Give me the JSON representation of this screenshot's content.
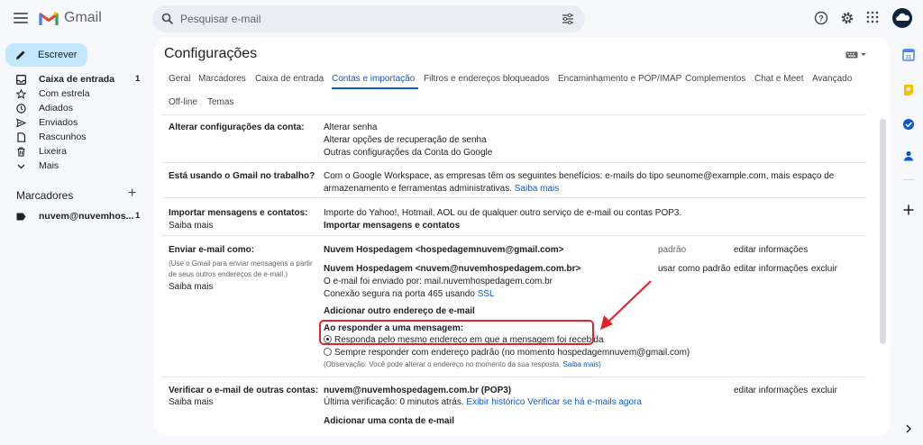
{
  "app": {
    "name": "Gmail"
  },
  "search": {
    "placeholder": "Pesquisar e-mail"
  },
  "nav": {
    "compose_label": "Escrever",
    "items": [
      {
        "label": "Caixa de entrada",
        "count": "1"
      },
      {
        "label": "Com estrela",
        "count": ""
      },
      {
        "label": "Adiados",
        "count": ""
      },
      {
        "label": "Enviados",
        "count": ""
      },
      {
        "label": "Rascunhos",
        "count": ""
      },
      {
        "label": "Lixeira",
        "count": ""
      },
      {
        "label": "Mais",
        "count": ""
      }
    ],
    "labels_title": "Marcadores",
    "label_items": [
      {
        "label": "nuvem@nuvemhos...",
        "count": "1"
      }
    ]
  },
  "settings": {
    "title": "Configurações",
    "tabs": [
      "Geral",
      "Marcadores",
      "Caixa de entrada",
      "Contas e importação",
      "Filtros e endereços bloqueados",
      "Encaminhamento e POP/IMAP",
      "Complementos",
      "Chat e Meet",
      "Avançado",
      "Off-line",
      "Temas"
    ],
    "active_tab": "Contas e importação",
    "change_account": {
      "label": "Alterar configurações da conta:",
      "links": [
        "Alterar senha",
        "Alterar opções de recuperação de senha",
        "Outras configurações da Conta do Google"
      ]
    },
    "workspace": {
      "label": "Está usando o Gmail no trabalho?",
      "text1": "Com o Google Workspace, as empresas têm os seguintes benefícios: e-mails do tipo seunome@example.com, mais espaço de",
      "text2": "armazenamento e ferramentas administrativas.",
      "link": "Saiba mais"
    },
    "import": {
      "label": "Importar mensagens e contatos:",
      "learn_more": "Saiba mais",
      "text": "Importe do Yahoo!, Hotmail, AOL ou de qualquer outro serviço de e-mail ou contas POP3.",
      "link": "Importar mensagens e contatos"
    },
    "send_as": {
      "label": "Enviar e-mail como:",
      "sub1": "(Use o Gmail para enviar mensagens a partir",
      "sub2": "de seus outros endereços de e-mail.)",
      "learn_more": "Saiba mais",
      "address1": "Nuvem Hospedagem <hospedagemnuvem@gmail.com>",
      "address1_default": "padrão",
      "address1_edit": "editar informações",
      "address2": "Nuvem Hospedagem <nuvem@nuvemhospedagem.com.br>",
      "address2_detail1": "O e-mail foi enviado por: mail.nuvemhospedagem.com.br",
      "address2_detail2": "Conexão segura na porta 465 usando",
      "address2_ssl": "SSL",
      "address2_make_default": "usar como padrão",
      "address2_edit": "editar informações",
      "address2_delete": "excluir",
      "add_another": "Adicionar outro endereço de e-mail",
      "reply_title": "Ao responder a uma mensagem:",
      "reply_opt1": "Responda pelo mesmo endereço em que a mensagem foi recebida",
      "reply_opt2": "Sempre responder com endereço padrão (no momento hospedagemnuvem@gmail.com)",
      "reply_note": "(Observação: Você pode alterar o endereço no momento da sua resposta.",
      "reply_note_link": "Saiba mais)"
    },
    "check_mail": {
      "label": "Verificar o e-mail de outras contas:",
      "learn_more": "Saiba mais",
      "account": "nuvem@nuvemhospedagem.com.br (POP3)",
      "last_check": "Última verificação: 0 minutos atrás.",
      "history_link": "Exibir histórico",
      "check_now_link": "Verificar se há e-mails agora",
      "edit": "editar informações",
      "delete": "excluir",
      "add_account": "Adicionar uma conta de e-mail"
    }
  },
  "colors": {
    "accent": "#0b57d0",
    "annotation": "#e0242b",
    "compose_bg": "#c2e7ff"
  }
}
